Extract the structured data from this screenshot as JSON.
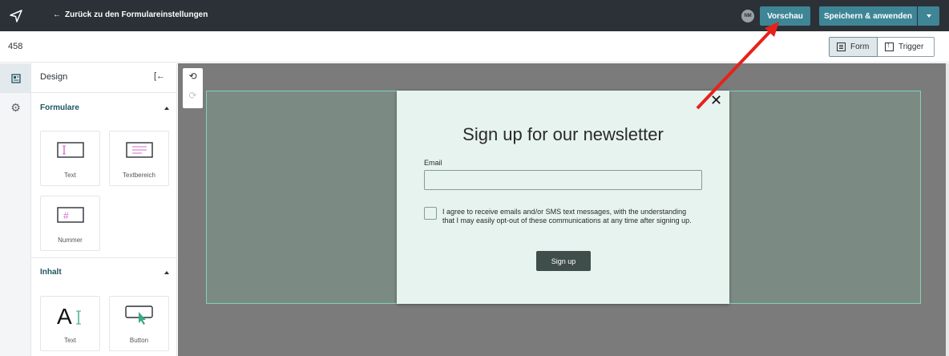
{
  "topbar": {
    "back_label": "Zurück zu den Formulareinstellungen",
    "avatar_initials": "NM",
    "preview_label": "Vorschau",
    "save_label": "Speichern & anwenden"
  },
  "subbar": {
    "form_id": "458",
    "tabs": [
      {
        "label": "Form",
        "icon": "form-icon",
        "active": true
      },
      {
        "label": "Trigger",
        "icon": "trigger-icon",
        "active": false
      }
    ]
  },
  "panel": {
    "title": "Design",
    "sections": [
      {
        "title": "Formulare",
        "items": [
          "Text",
          "Textbereich",
          "Nummer"
        ]
      },
      {
        "title": "Inhalt",
        "items": [
          "Text",
          "Button"
        ]
      }
    ]
  },
  "modal": {
    "title": "Sign up for our newsletter",
    "email_label": "Email",
    "email_value": "",
    "consent_text": "I agree to receive emails and/or SMS text messages, with the understanding that I may easily opt-out of these communications at any time after signing up.",
    "button_label": "Sign up"
  },
  "colors": {
    "topbar": "#2b3137",
    "accent": "#3e8596",
    "overlay_border": "#7fd3b8",
    "modal_bg": "#e6f3ef",
    "annotation_arrow": "#e5231b"
  }
}
